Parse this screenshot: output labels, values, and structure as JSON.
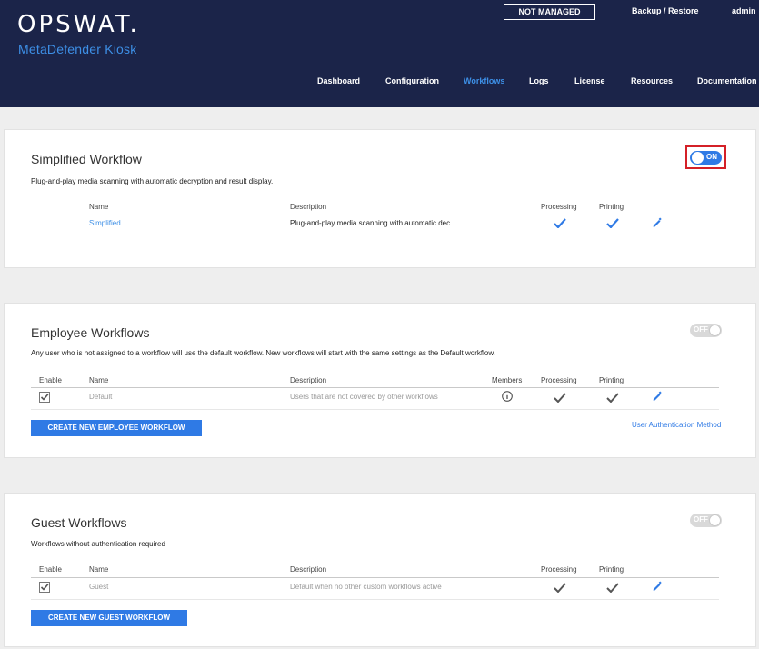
{
  "header": {
    "logo": "OPSWAT.",
    "product": "MetaDefender Kiosk",
    "badge": "NOT MANAGED",
    "backup_link": "Backup / Restore",
    "user": "admin",
    "nav": [
      "Dashboard",
      "Configuration",
      "Workflows",
      "Logs",
      "License",
      "Resources",
      "Documentation"
    ],
    "active_nav": "Workflows"
  },
  "simplified": {
    "title": "Simplified Workflow",
    "description": "Plug-and-play media scanning with automatic decryption and result display.",
    "toggle_label": "ON",
    "columns": {
      "name": "Name",
      "description": "Description",
      "processing": "Processing",
      "printing": "Printing"
    },
    "rows": [
      {
        "name": "Simplified",
        "description": "Plug-and-play media scanning with automatic dec..."
      }
    ]
  },
  "employee": {
    "title": "Employee Workflows",
    "description": "Any user who is not assigned to a workflow will use the default workflow. New workflows will start with the same settings as the Default workflow.",
    "toggle_label": "OFF",
    "columns": {
      "enable": "Enable",
      "name": "Name",
      "description": "Description",
      "members": "Members",
      "processing": "Processing",
      "printing": "Printing"
    },
    "rows": [
      {
        "name": "Default",
        "description": "Users that are not covered by other workflows"
      }
    ],
    "create_button": "CREATE NEW EMPLOYEE WORKFLOW",
    "auth_link": "User Authentication Method"
  },
  "guest": {
    "title": "Guest Workflows",
    "description": "Workflows without authentication required",
    "toggle_label": "OFF",
    "columns": {
      "enable": "Enable",
      "name": "Name",
      "description": "Description",
      "processing": "Processing",
      "printing": "Printing"
    },
    "rows": [
      {
        "name": "Guest",
        "description": "Default when no other custom workflows active"
      }
    ],
    "create_button": "CREATE NEW GUEST WORKFLOW"
  },
  "colors": {
    "header_bg": "#1b2449",
    "accent": "#2f7ae5",
    "highlight": "#d42027"
  },
  "icons": [
    "check-icon",
    "pencil-icon",
    "info-icon",
    "checkbox-checked-icon"
  ]
}
